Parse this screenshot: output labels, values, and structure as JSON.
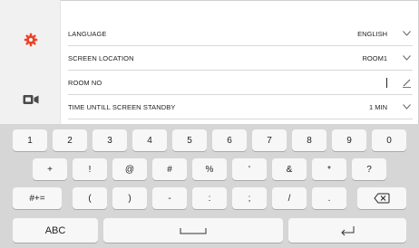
{
  "sidebar": {
    "items": [
      {
        "icon": "gear-icon",
        "color": "#e8452c"
      },
      {
        "icon": "video-camera-icon",
        "color": "#4a4a4a"
      }
    ]
  },
  "settings": {
    "rows": [
      {
        "label": "LANGUAGE",
        "value": "ENGLISH",
        "control": "chevron-down-icon"
      },
      {
        "label": "SCREEN LOCATION",
        "value": "ROOM1",
        "control": "chevron-down-icon"
      },
      {
        "label": "ROOM NO",
        "value": "",
        "control": "edit-pencil-icon"
      },
      {
        "label": "TIME UNTILL SCREEN STANDBY",
        "value": "1 MIN",
        "control": "chevron-down-icon"
      }
    ]
  },
  "keyboard": {
    "row1": [
      "1",
      "2",
      "3",
      "4",
      "5",
      "6",
      "7",
      "8",
      "9",
      "0"
    ],
    "row2": [
      "+",
      "!",
      "@",
      "#",
      "%",
      "'",
      "&",
      "*",
      "?"
    ],
    "row3_mode": "#+=",
    "row3": [
      "(",
      ")",
      "-",
      ":",
      ";",
      "/",
      "."
    ],
    "backspace_icon": "backspace-icon",
    "abc_label": "ABC",
    "space_icon": "space-icon",
    "enter_icon": "enter-icon"
  },
  "colors": {
    "accent": "#e8452c",
    "keyboard_bg": "#d6d6d6",
    "key_bg": "#f7f7f7"
  }
}
